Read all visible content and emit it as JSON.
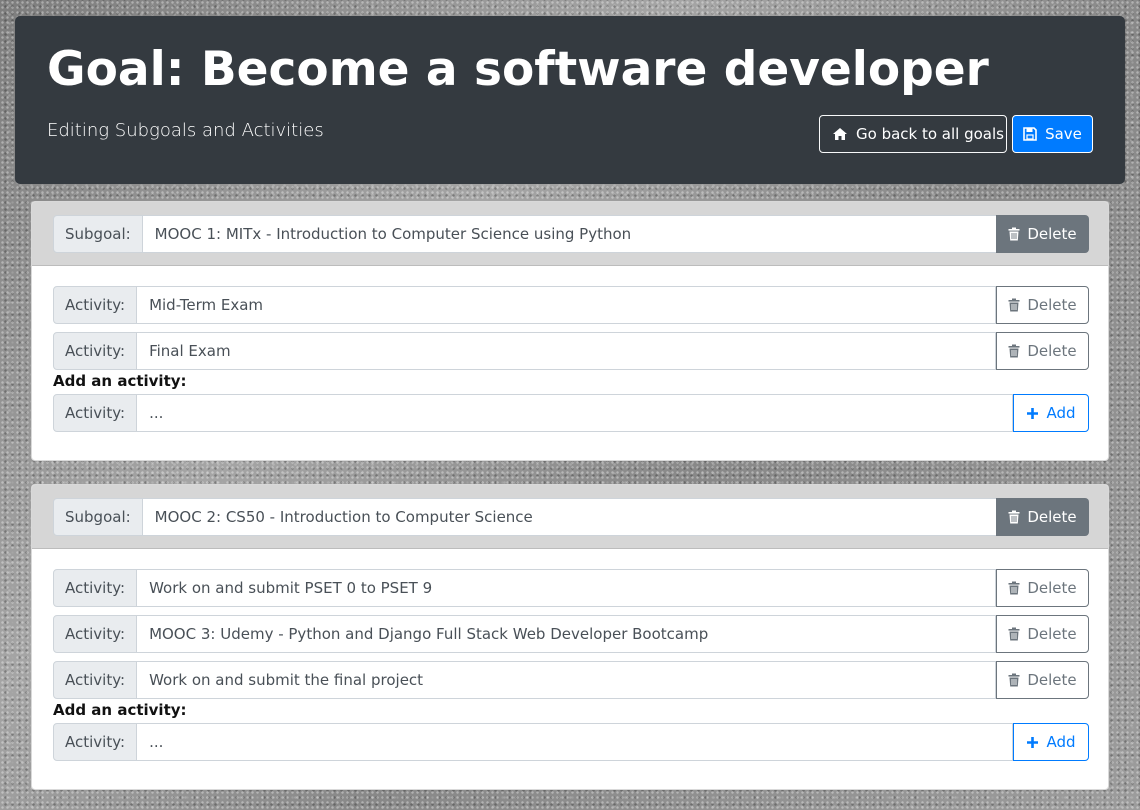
{
  "header": {
    "title": "Goal: Become a software developer",
    "subtitle": "Editing Subgoals and Activities",
    "back_label": "Go back to all goals",
    "save_label": "Save"
  },
  "subgoal_prefix": "Subgoal:",
  "activity_prefix": "Activity:",
  "delete_label": "Delete",
  "add_label": "Add",
  "add_activity_heading": "Add an activity:",
  "new_activity_placeholder": "...",
  "subgoals": [
    {
      "name": "MOOC 1: MITx - Introduction to Computer Science using Python",
      "activities": [
        "Mid-Term Exam",
        "Final Exam"
      ]
    },
    {
      "name": "MOOC 2: CS50 - Introduction to Computer Science",
      "activities": [
        "Work on and submit PSET 0 to PSET 9",
        "MOOC 3: Udemy - Python and Django Full Stack Web Developer Bootcamp",
        "Work on and submit the final project"
      ]
    }
  ],
  "colors": {
    "header_bg": "#343a40",
    "primary": "#007bff",
    "secondary": "#6c757d"
  }
}
